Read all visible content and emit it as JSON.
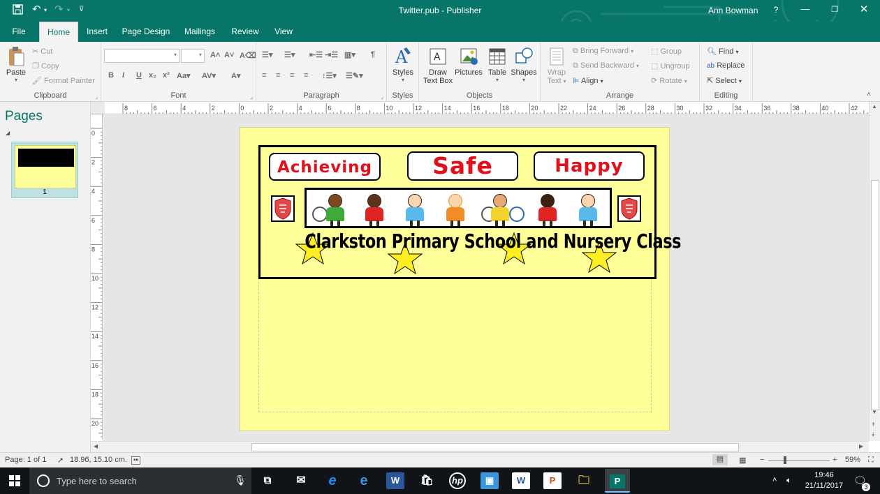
{
  "title": {
    "document_name": "Twitter.pub",
    "separator": "-",
    "app_name": "Publisher",
    "user_name": "Ann Bowman",
    "help": "?"
  },
  "tabs": [
    "File",
    "Home",
    "Insert",
    "Page Design",
    "Mailings",
    "Review",
    "View"
  ],
  "active_tab": "Home",
  "ribbon": {
    "clipboard": {
      "paste": "Paste",
      "cut": "Cut",
      "copy": "Copy",
      "format_painter": "Format Painter",
      "label": "Clipboard"
    },
    "font": {
      "label": "Font"
    },
    "paragraph": {
      "label": "Paragraph"
    },
    "styles": {
      "button": "Styles",
      "label": "Styles"
    },
    "objects": {
      "draw_text_box_1": "Draw",
      "draw_text_box_2": "Text Box",
      "pictures": "Pictures",
      "table": "Table",
      "shapes": "Shapes",
      "label": "Objects"
    },
    "arrange": {
      "wrap_text_1": "Wrap",
      "wrap_text_2": "Text",
      "bring_forward": "Bring Forward",
      "send_backward": "Send Backward",
      "align": "Align",
      "group": "Group",
      "ungroup": "Ungroup",
      "rotate": "Rotate",
      "label": "Arrange"
    },
    "editing": {
      "find": "Find",
      "replace": "Replace",
      "select": "Select",
      "label": "Editing"
    }
  },
  "pages_panel": {
    "header": "Pages",
    "thumbnail_number": "1"
  },
  "rulers": {
    "horizontal": [
      "8",
      "6",
      "4",
      "2",
      "0",
      "2",
      "4",
      "6",
      "8",
      "10",
      "12",
      "14",
      "16",
      "18",
      "20",
      "22",
      "24",
      "26",
      "28",
      "30",
      "32",
      "34",
      "36",
      "38",
      "40",
      "42"
    ],
    "vertical": [
      "0",
      "2",
      "4",
      "6",
      "8",
      "10",
      "12",
      "14",
      "16",
      "18",
      "20"
    ]
  },
  "document": {
    "labels": [
      "Achieving",
      "Safe",
      "Happy"
    ],
    "school_name": "Clarkston Primary School and Nursery Class",
    "colors": {
      "page": "#ffff99",
      "label_text": "#e3101c",
      "star": "#ffee22"
    }
  },
  "status": {
    "page": "Page: 1 of 1",
    "position": "18.96, 15.10 cm.",
    "zoom": "59%"
  },
  "taskbar": {
    "search_placeholder": "Type here to search",
    "time": "19:46",
    "date": "21/11/2017",
    "notification_count": "3"
  }
}
